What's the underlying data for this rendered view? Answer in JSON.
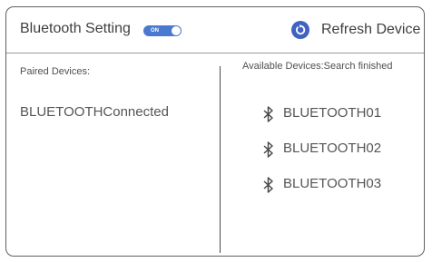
{
  "header": {
    "title": "Bluetooth Setting",
    "toggle": {
      "label": "ON",
      "state": "on",
      "color": "#4a79cf"
    },
    "refresh": {
      "label": "Refresh Device",
      "icon": "refresh-icon",
      "color": "#3f63c2"
    }
  },
  "paired": {
    "title": "Paired Devices:",
    "devices": [
      {
        "label": "BLUETOOTHConnected"
      }
    ]
  },
  "available": {
    "title": "Available Devices:Search finished",
    "devices": [
      {
        "label": "BLUETOOTH01",
        "icon": "bluetooth-icon"
      },
      {
        "label": "BLUETOOTH02",
        "icon": "bluetooth-icon"
      },
      {
        "label": "BLUETOOTH03",
        "icon": "bluetooth-icon"
      }
    ]
  }
}
